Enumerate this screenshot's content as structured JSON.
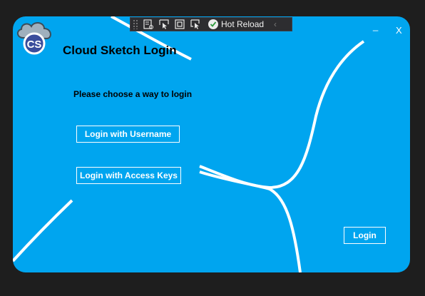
{
  "app": {
    "title": "Cloud Sketch Login",
    "logo_text": "CS",
    "subtitle": "Please choose a way to login"
  },
  "buttons": {
    "username": "Login with Username",
    "access_keys": "Login with Access Keys",
    "login": "Login"
  },
  "window_controls": {
    "minimize": "_",
    "close": "X"
  },
  "dev_toolbar": {
    "hot_reload_label": "Hot Reload",
    "collapse_glyph": "‹",
    "icons": [
      "live-visual-tree-icon",
      "select-element-icon",
      "display-layout-adorners-icon",
      "track-focused-element-icon"
    ]
  },
  "colors": {
    "background": "#00a5ef",
    "accent": "#ffffff",
    "toolbar": "#2d2d30"
  }
}
